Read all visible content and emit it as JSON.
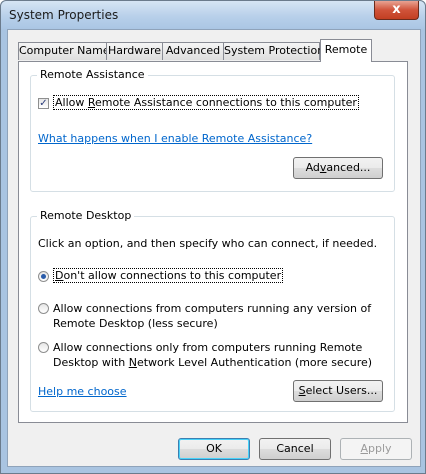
{
  "window": {
    "title": "System Properties",
    "close_label": "x"
  },
  "tabs": [
    {
      "label": "Computer Name"
    },
    {
      "label": "Hardware"
    },
    {
      "label": "Advanced"
    },
    {
      "label": "System Protection"
    },
    {
      "label": "Remote"
    }
  ],
  "remote_assistance": {
    "group_title": "Remote Assistance",
    "allow_checkbox": {
      "label_pre": "Allow ",
      "label_accel": "R",
      "label_post": "emote Assistance connections to this computer",
      "checked": true
    },
    "help_link": "What happens when I enable Remote Assistance?",
    "advanced_button": {
      "pre": "Ad",
      "accel": "v",
      "post": "anced..."
    }
  },
  "remote_desktop": {
    "group_title": "Remote Desktop",
    "intro": "Click an option, and then specify who can connect, if needed.",
    "options": [
      {
        "pre": "",
        "accel": "D",
        "post": "on't allow connections to this computer",
        "checked": true
      },
      {
        "line1": "Allow connections from computers running any version of",
        "line2": "Remote Desktop (less secure)",
        "checked": false
      },
      {
        "line1": "Allow connections only from computers running Remote",
        "line2_pre": "Desktop with ",
        "line2_accel": "N",
        "line2_post": "etwork Level Authentication (more secure)",
        "checked": false
      }
    ],
    "help_link": "Help me choose",
    "select_users_button": {
      "pre": "",
      "accel": "S",
      "post": "elect Users..."
    }
  },
  "footer": {
    "ok": "OK",
    "cancel": "Cancel",
    "apply_accel": "A",
    "apply_post": "pply"
  }
}
